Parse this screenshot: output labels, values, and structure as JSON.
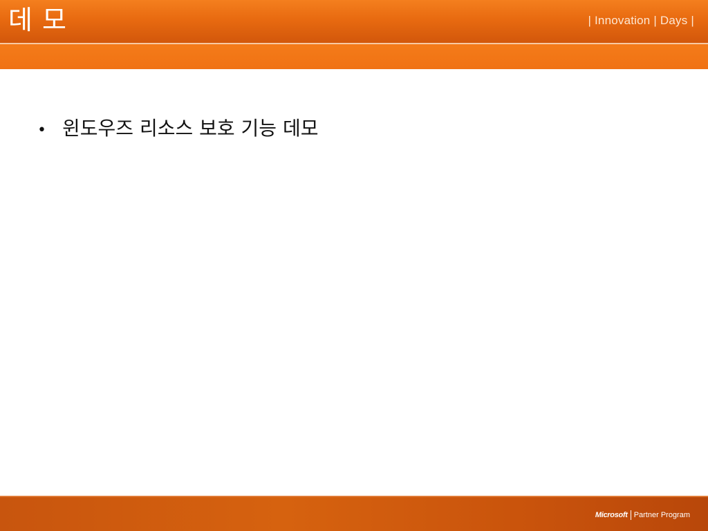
{
  "slide": {
    "title": "데 모",
    "brand_tag": "| Innovation | Days |",
    "bullets": [
      "윈도우즈 리소스 보호 기능 데모"
    ],
    "bullet_marker": "•"
  },
  "footer": {
    "logo_mark": "Microsoft",
    "logo_text": "Partner Program"
  },
  "colors": {
    "header_orange": "#e86a10",
    "band_orange": "#f47b19",
    "footer_orange": "#c8550e",
    "text_dark": "#111111",
    "text_light": "#ffffff"
  }
}
